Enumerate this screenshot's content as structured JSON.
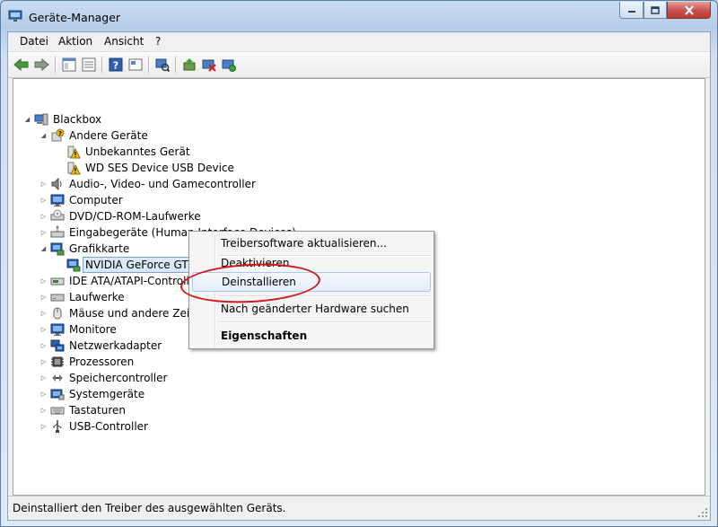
{
  "window": {
    "title": "Geräte-Manager"
  },
  "menu": [
    "Datei",
    "Aktion",
    "Ansicht",
    "?"
  ],
  "toolbar_icons": [
    "back-icon",
    "forward-icon",
    "properties-icon",
    "view-icon",
    "help-icon",
    "console-icon",
    "scan-hardware-icon",
    "update-driver-icon",
    "uninstall-icon",
    "enable-device-icon"
  ],
  "tree": [
    {
      "label": "Blackbox",
      "level": 0,
      "expander": "open",
      "icon": "computer-icon"
    },
    {
      "label": "Andere Geräte",
      "level": 1,
      "expander": "open",
      "icon": "unknown-device-icon"
    },
    {
      "label": "Unbekanntes Gerät",
      "level": 2,
      "expander": "none",
      "icon": "warning-device-icon"
    },
    {
      "label": "WD SES Device USB Device",
      "level": 2,
      "expander": "none",
      "icon": "warning-device-icon"
    },
    {
      "label": "Audio-, Video- und Gamecontroller",
      "level": 1,
      "expander": "closed",
      "icon": "speaker-icon"
    },
    {
      "label": "Computer",
      "level": 1,
      "expander": "closed",
      "icon": "monitor-icon"
    },
    {
      "label": "DVD/CD-ROM-Laufwerke",
      "level": 1,
      "expander": "closed",
      "icon": "dvd-drive-icon"
    },
    {
      "label": "Eingabegeräte (Human Interface Devices)",
      "level": 1,
      "expander": "closed",
      "icon": "hid-icon"
    },
    {
      "label": "Grafikkarte",
      "level": 1,
      "expander": "open",
      "icon": "display-adapter-icon"
    },
    {
      "label": "NVIDIA GeForce GTX 980 Ti",
      "level": 2,
      "expander": "none",
      "icon": "display-adapter-icon",
      "selected": true
    },
    {
      "label": "IDE ATA/ATAPI-Controller",
      "level": 1,
      "expander": "closed",
      "icon": "ide-controller-icon"
    },
    {
      "label": "Laufwerke",
      "level": 1,
      "expander": "closed",
      "icon": "disk-drive-icon"
    },
    {
      "label": "Mäuse und andere Zeigegeräte",
      "level": 1,
      "expander": "closed",
      "icon": "mouse-icon"
    },
    {
      "label": "Monitore",
      "level": 1,
      "expander": "closed",
      "icon": "monitor-icon"
    },
    {
      "label": "Netzwerkadapter",
      "level": 1,
      "expander": "closed",
      "icon": "network-adapter-icon"
    },
    {
      "label": "Prozessoren",
      "level": 1,
      "expander": "closed",
      "icon": "processor-icon"
    },
    {
      "label": "Speichercontroller",
      "level": 1,
      "expander": "closed",
      "icon": "storage-controller-icon"
    },
    {
      "label": "Systemgeräte",
      "level": 1,
      "expander": "closed",
      "icon": "system-device-icon"
    },
    {
      "label": "Tastaturen",
      "level": 1,
      "expander": "closed",
      "icon": "keyboard-icon"
    },
    {
      "label": "USB-Controller",
      "level": 1,
      "expander": "closed",
      "icon": "usb-icon"
    }
  ],
  "context_menu": [
    {
      "label": "Treibersoftware aktualisieren...",
      "style": "normal"
    },
    {
      "label": "Deaktivieren",
      "style": "normal"
    },
    {
      "label": "Deinstallieren",
      "style": "hover"
    },
    {
      "label": "Nach geänderter Hardware suchen",
      "style": "normal"
    },
    {
      "label": "Eigenschaften",
      "style": "bold"
    }
  ],
  "status": {
    "text": "Deinstalliert den Treiber des ausgewählten Geräts."
  }
}
